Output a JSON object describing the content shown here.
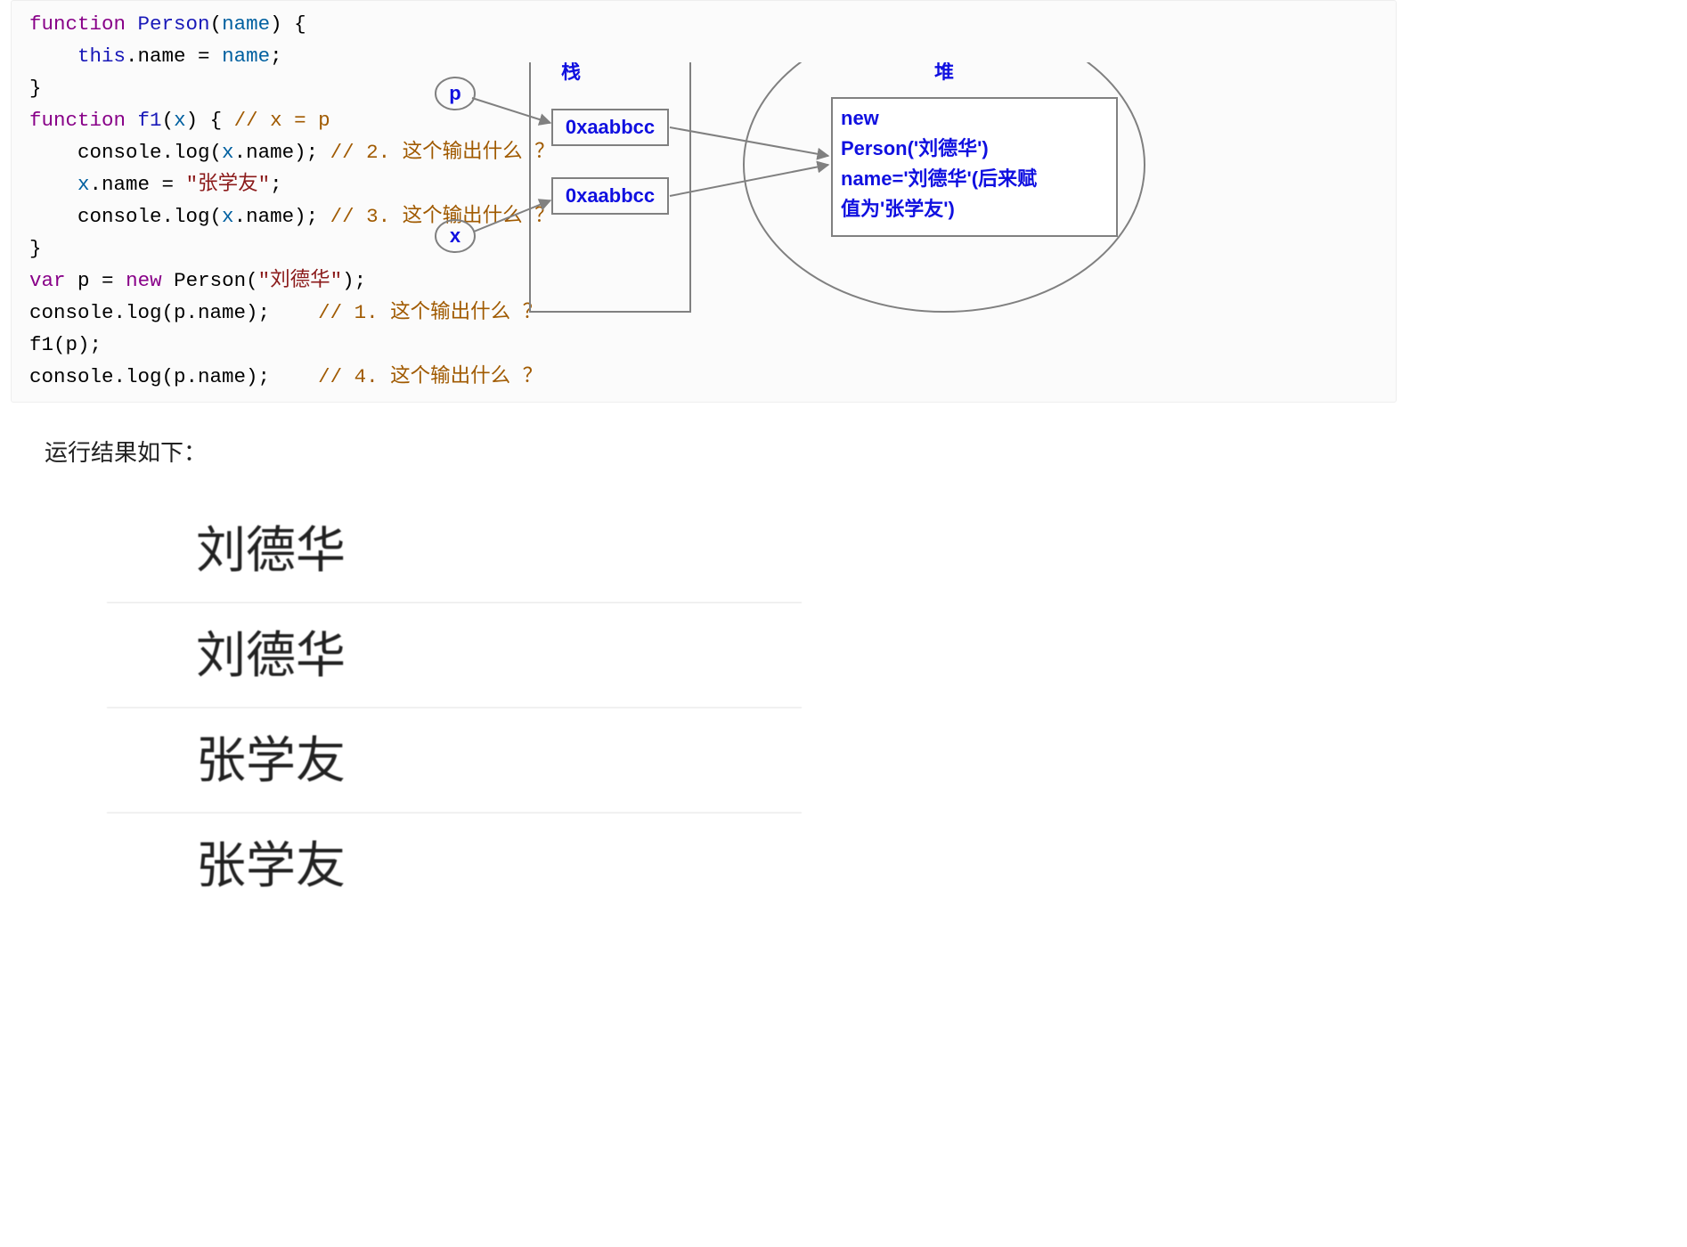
{
  "code": {
    "keywords": {
      "function": "function",
      "var": "var",
      "new": "new",
      "this": "this"
    },
    "person_fn_name": "Person",
    "person_param": "name",
    "assign_name": ".name = ",
    "semicolon": ";",
    "brace_open": " {",
    "brace_close": "}",
    "f1_name": "f1",
    "f1_param": "x",
    "f1_cmt_assign": "// x = p",
    "console_log": "console.log(",
    "dot_name_close": ".name);",
    "cmt2": "// 2. 这个输出什么 ？",
    "x_assign_str": " = ",
    "str_zxy": "\"张学友\"",
    "cmt3": "// 3. 这个输出什么 ？",
    "p_var": "p",
    "eq_new": " = ",
    "person_call_open": "Person(",
    "str_ldh": "\"刘德华\"",
    "close_paren_semi": ");",
    "cmt1": "// 1. 这个输出什么 ？",
    "f1_call": "f1(p);",
    "cmt4": "// 4. 这个输出什么 ？"
  },
  "diagram": {
    "p_label": "p",
    "x_label": "x",
    "stack_label": "栈",
    "heap_label": "堆",
    "addr": "0xaabbcc",
    "heap_line1": "new",
    "heap_line2": "Person('刘德华')",
    "heap_line3": "name='刘德华'(后来赋",
    "heap_line4": "值为'张学友')"
  },
  "result_label": "运行结果如下：",
  "results": [
    "刘德华",
    "刘德华",
    "张学友",
    "张学友"
  ]
}
